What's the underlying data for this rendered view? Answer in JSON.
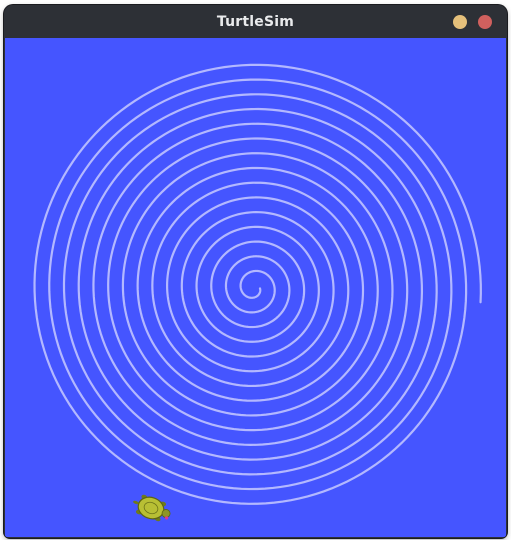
{
  "window": {
    "title": "TurtleSim",
    "background_color": "#4555ff",
    "pen_color": "#b3b8ff",
    "controls": {
      "minimize_color": "#e5c07b",
      "close_color": "#d0605e"
    }
  },
  "turtle": {
    "icon": "turtle-icon",
    "shell_color": "#b8bf34",
    "heading_degrees": 20
  },
  "drawing": {
    "shape": "spiral",
    "turns": 15
  }
}
